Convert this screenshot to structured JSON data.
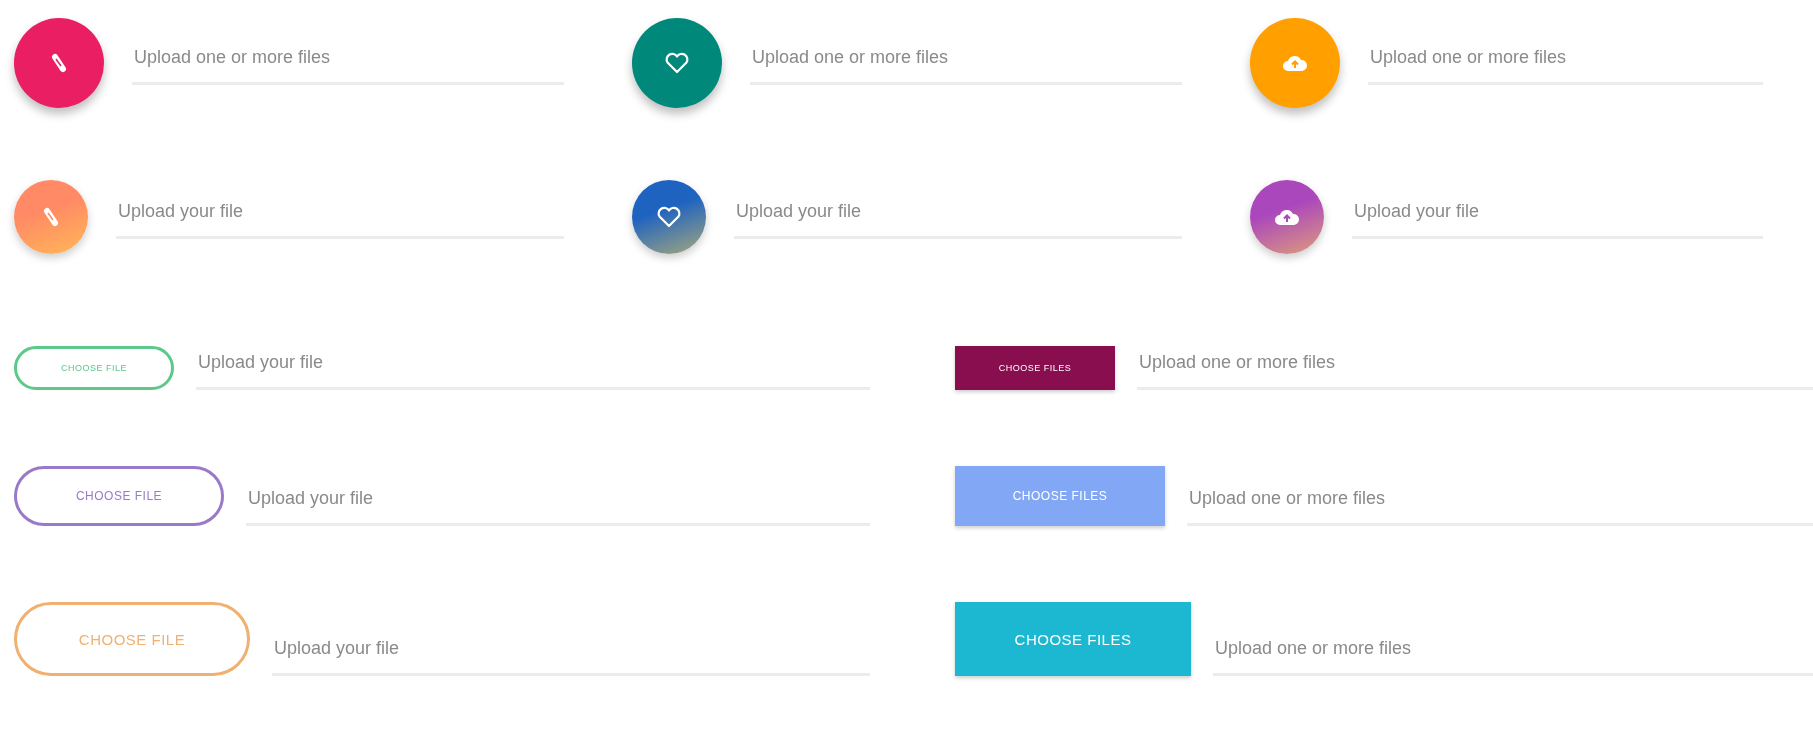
{
  "icon_rows": [
    {
      "items": [
        {
          "color": "#e91e63",
          "placeholder": "Upload one or more files"
        },
        {
          "color": "#00897b",
          "placeholder": "Upload one or more files"
        },
        {
          "color": "#ffa000",
          "placeholder": "Upload one or more files"
        }
      ]
    },
    {
      "items": [
        {
          "color": "#ff8a65",
          "placeholder": "Upload your file"
        },
        {
          "color": "#1e63c0",
          "placeholder": "Upload your file"
        },
        {
          "color": "#ab47bc",
          "placeholder": "Upload your file"
        }
      ]
    }
  ],
  "button_rows": [
    {
      "left": {
        "kind": "outline",
        "color": "#5cc98a",
        "label": "CHOOSE FILE",
        "placeholder": "Upload your file"
      },
      "right": {
        "kind": "solid",
        "color": "#880e4f",
        "label": "CHOOSE FILES",
        "placeholder": "Upload one or more files"
      }
    },
    {
      "left": {
        "kind": "outline",
        "color": "#9a7ac8",
        "label": "CHOOSE FILE",
        "placeholder": "Upload your file"
      },
      "right": {
        "kind": "solid",
        "color": "#82a8f5",
        "label": "CHOOSE FILES",
        "placeholder": "Upload one or more files"
      }
    },
    {
      "left": {
        "kind": "outline",
        "color": "#f0b070",
        "label": "CHOOSE FILE",
        "placeholder": "Upload your file"
      },
      "right": {
        "kind": "solid",
        "color": "#1cb8d2",
        "label": "CHOOSE FILES",
        "placeholder": "Upload one or more files"
      }
    }
  ]
}
